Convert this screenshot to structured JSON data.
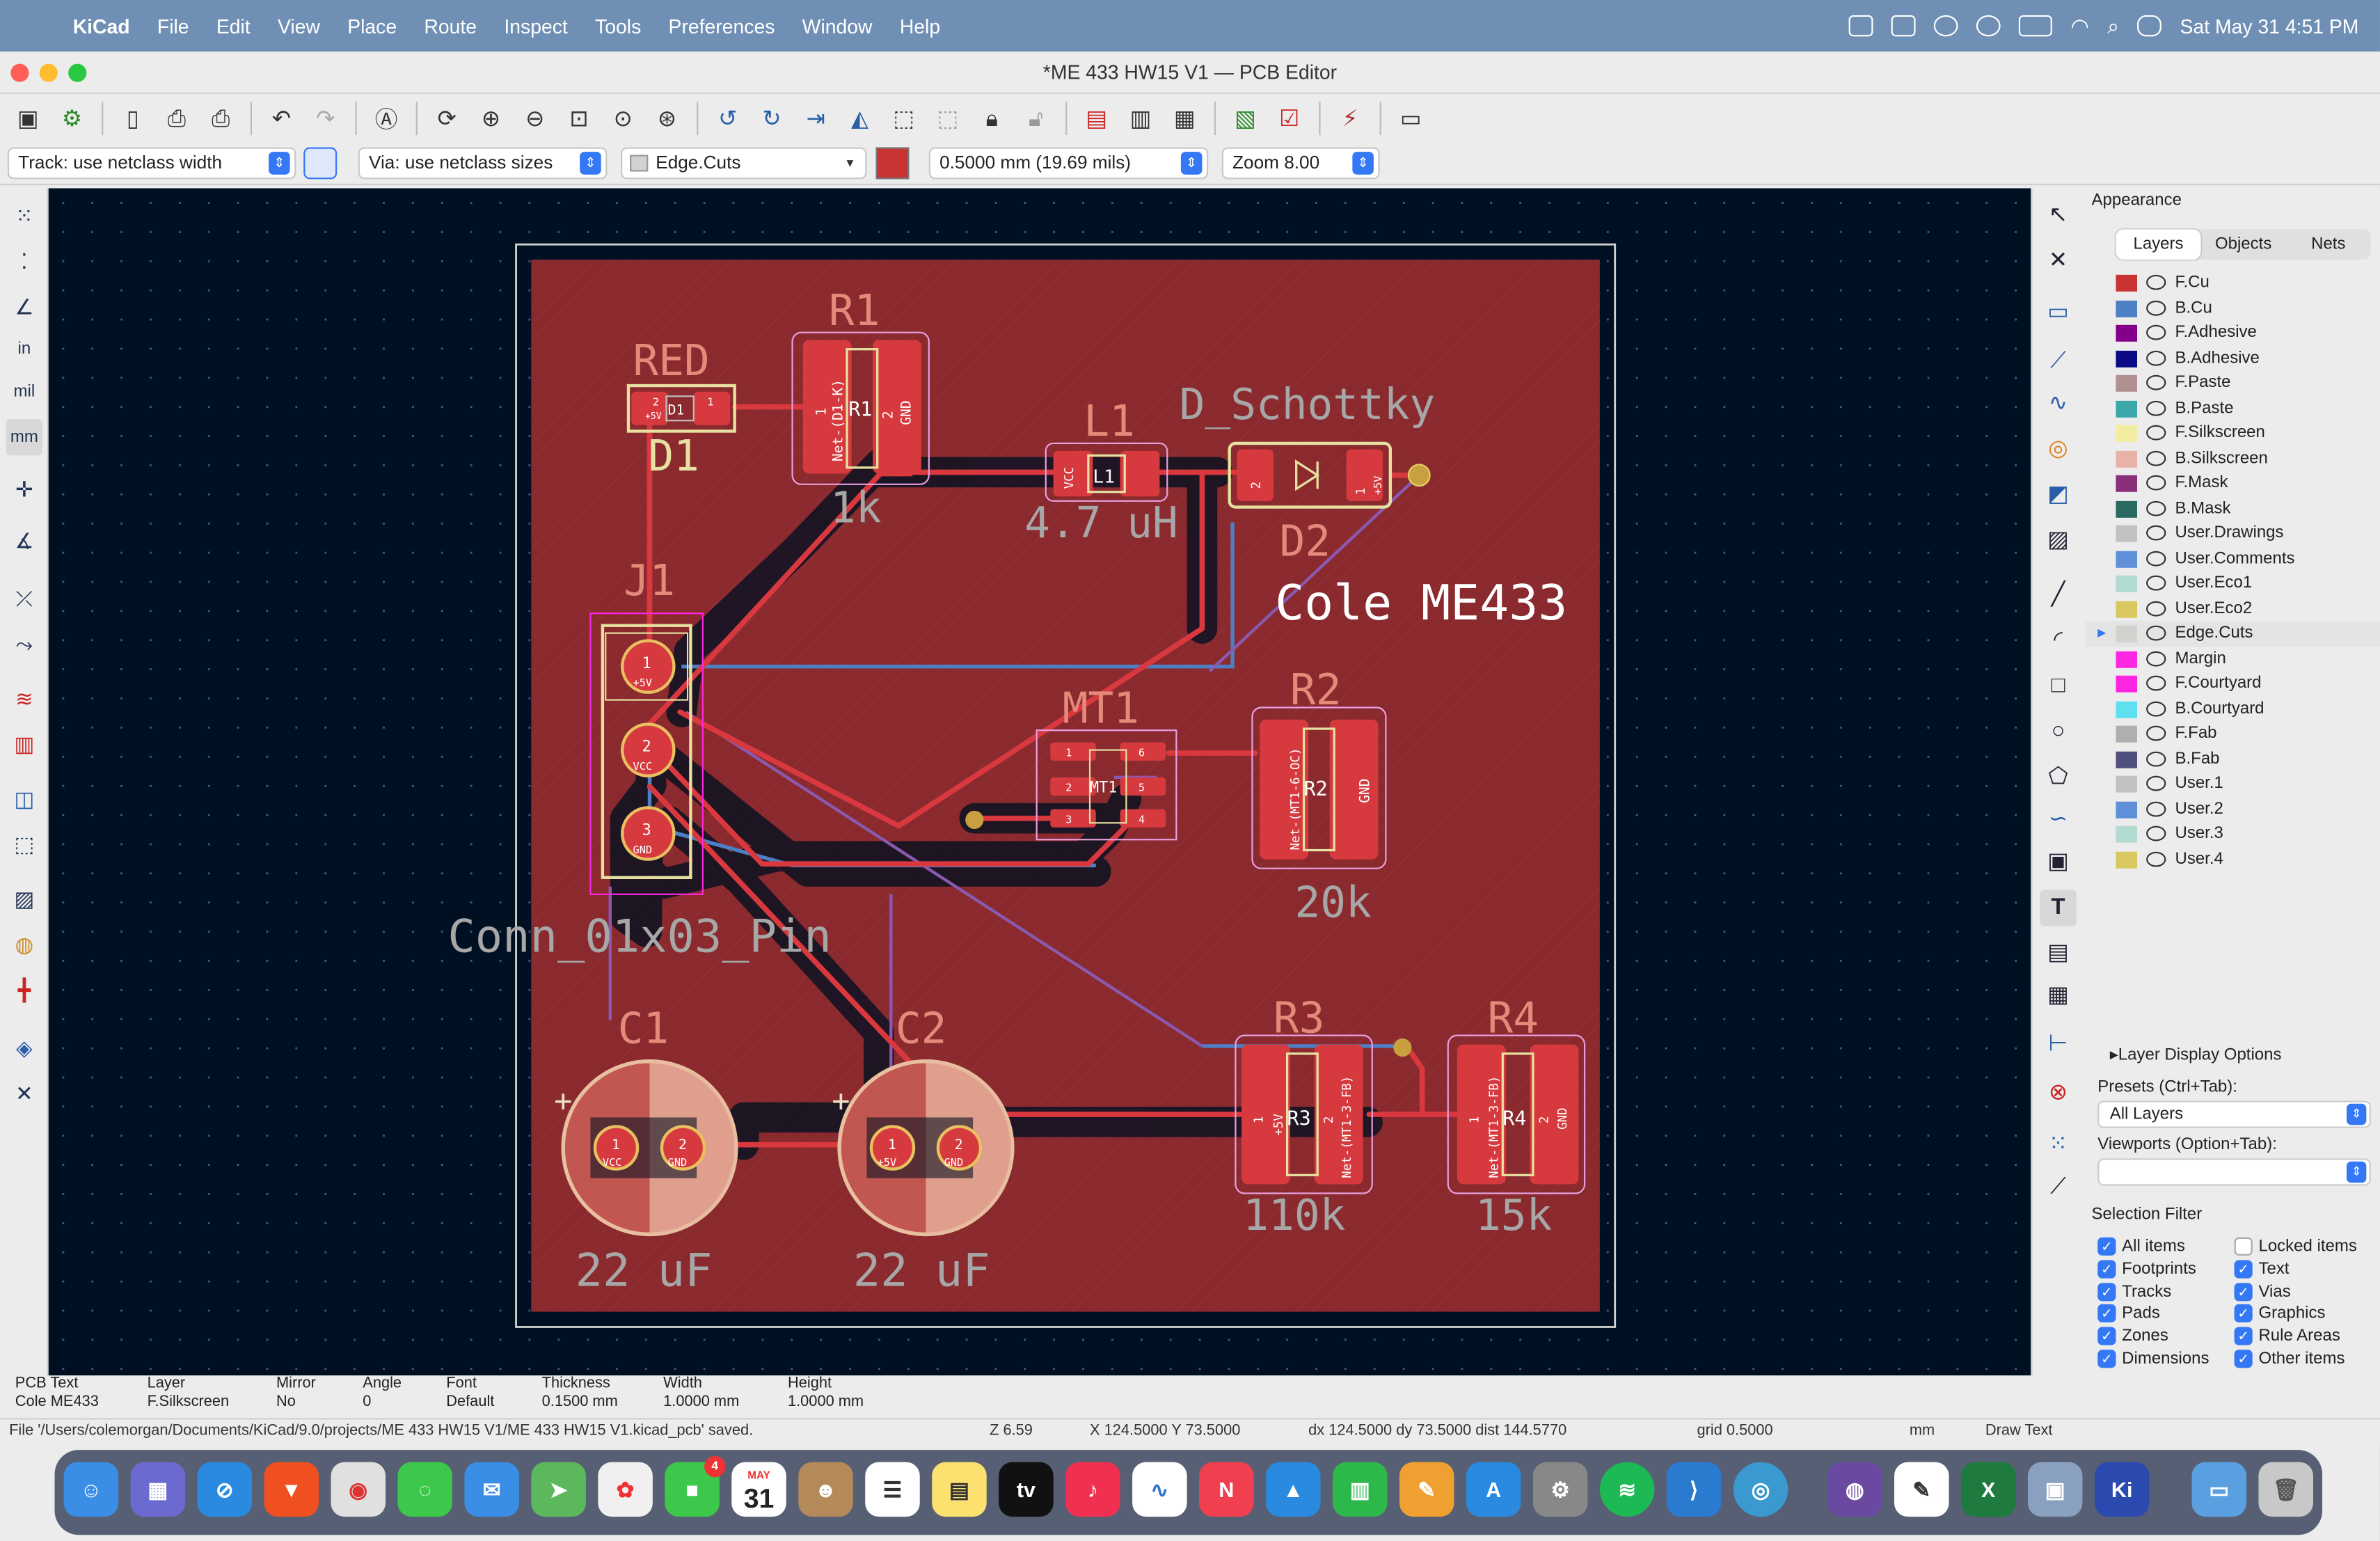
{
  "menubar": {
    "app": "KiCad",
    "items": [
      "File",
      "Edit",
      "View",
      "Place",
      "Route",
      "Inspect",
      "Tools",
      "Preferences",
      "Window",
      "Help"
    ],
    "datetime": "Sat May 31  4:51 PM"
  },
  "window": {
    "title": "*ME 433 HW15 V1 — PCB Editor"
  },
  "options": {
    "track": "Track: use netclass width",
    "via": "Via: use netclass sizes",
    "layer": "Edge.Cuts",
    "line_width": "0.5000 mm (19.69 mils)",
    "zoom": "Zoom 8.00"
  },
  "lefttools": {
    "in": "in",
    "mil": "mil",
    "mm": "mm"
  },
  "board": {
    "labels": {
      "red": "RED",
      "d1": "D1",
      "r1": "R1",
      "r1_val": "1k",
      "l1": "L1",
      "l1_val": "4.7 uH",
      "dsch": "D_Schottky",
      "d2": "D2",
      "cole": "Cole ME433",
      "j1": "J1",
      "mt1": "MT1",
      "r2": "R2",
      "r2_val": "20k",
      "conn": "Conn_01x03_Pin",
      "c1": "C1",
      "c2": "C2",
      "c1_val": "22 uF",
      "c2_val": "22 uF",
      "r3": "R3",
      "r3_val": "110k",
      "r4": "R4",
      "r4_val": "15k"
    },
    "pads": {
      "p1": "1",
      "p2": "2",
      "p3": "3",
      "p4": "4",
      "p5": "5",
      "p6": "6",
      "plus5v": "+5V",
      "vcc": "VCC",
      "gnd": "GND",
      "plus": "+",
      "net_d1k": "Net-(D1-K)",
      "net_mt16": "Net-(MT1-6-OC)",
      "net_mt13": "Net-(MT1-3-FB)",
      "r1_ref": "R1",
      "l1_ref": "L1",
      "mt1_ref": "MT1",
      "r2_ref": "R2",
      "r3_ref": "R3",
      "r4_ref": "R4",
      "d1_ref": "D1"
    }
  },
  "appearance": {
    "title": "Appearance",
    "tabs": [
      "Layers",
      "Objects",
      "Nets"
    ],
    "layers": [
      {
        "name": "F.Cu",
        "color": "#c83434"
      },
      {
        "name": "B.Cu",
        "color": "#4d7fc4"
      },
      {
        "name": "F.Adhesive",
        "color": "#84008b"
      },
      {
        "name": "B.Adhesive",
        "color": "#0a0a84"
      },
      {
        "name": "F.Paste",
        "color": "#b09090"
      },
      {
        "name": "B.Paste",
        "color": "#3aa8a8"
      },
      {
        "name": "F.Silkscreen",
        "color": "#f2eda1"
      },
      {
        "name": "B.Silkscreen",
        "color": "#e8b2a7"
      },
      {
        "name": "F.Mask",
        "color": "#8a2f7a"
      },
      {
        "name": "B.Mask",
        "color": "#2a6a60"
      },
      {
        "name": "User.Drawings",
        "color": "#c2c2c2"
      },
      {
        "name": "User.Comments",
        "color": "#5e8fd8"
      },
      {
        "name": "User.Eco1",
        "color": "#b4dbd2"
      },
      {
        "name": "User.Eco2",
        "color": "#d8c85f"
      },
      {
        "name": "Edge.Cuts",
        "color": "#d0d2cd"
      },
      {
        "name": "Margin",
        "color": "#ff26e2"
      },
      {
        "name": "F.Courtyard",
        "color": "#ff26e2"
      },
      {
        "name": "B.Courtyard",
        "color": "#5ee0f0"
      },
      {
        "name": "F.Fab",
        "color": "#afafaf"
      },
      {
        "name": "B.Fab",
        "color": "#505080"
      },
      {
        "name": "User.1",
        "color": "#c2c2c2"
      },
      {
        "name": "User.2",
        "color": "#5e8fd8"
      },
      {
        "name": "User.3",
        "color": "#b4dbd2"
      },
      {
        "name": "User.4",
        "color": "#d8c85f"
      }
    ],
    "layer_display_options": "Layer Display Options",
    "presets_label": "Presets (Ctrl+Tab):",
    "presets_value": "All Layers",
    "viewports_label": "Viewports (Option+Tab):"
  },
  "selection_filter": {
    "title": "Selection Filter",
    "items": [
      {
        "label": "All items",
        "checked": true
      },
      {
        "label": "Locked items",
        "checked": false
      },
      {
        "label": "Footprints",
        "checked": true
      },
      {
        "label": "Text",
        "checked": true
      },
      {
        "label": "Tracks",
        "checked": true
      },
      {
        "label": "Vias",
        "checked": true
      },
      {
        "label": "Pads",
        "checked": true
      },
      {
        "label": "Graphics",
        "checked": true
      },
      {
        "label": "Zones",
        "checked": true
      },
      {
        "label": "Rule Areas",
        "checked": true
      },
      {
        "label": "Dimensions",
        "checked": true
      },
      {
        "label": "Other items",
        "checked": true
      }
    ]
  },
  "message_panel": [
    {
      "h": "PCB Text",
      "v": "Cole ME433"
    },
    {
      "h": "Layer",
      "v": "F.Silkscreen"
    },
    {
      "h": "Mirror",
      "v": "No"
    },
    {
      "h": "Angle",
      "v": "0"
    },
    {
      "h": "Font",
      "v": "Default"
    },
    {
      "h": "Thickness",
      "v": "0.1500 mm"
    },
    {
      "h": "Width",
      "v": "1.0000 mm"
    },
    {
      "h": "Height",
      "v": "1.0000 mm"
    }
  ],
  "status": {
    "file": "File '/Users/colemorgan/Documents/KiCad/9.0/projects/ME 433 HW15 V1/ME 433 HW15 V1.kicad_pcb' saved.",
    "z": "Z 6.59",
    "xy": "X 124.5000  Y 73.5000",
    "dxy": "dx 124.5000  dy 73.5000  dist 144.5770",
    "grid": "grid 0.5000",
    "units": "mm",
    "mode": "Draw Text"
  },
  "dock": {
    "calendar_month": "MAY",
    "calendar_day": "31",
    "messages_badge": "4",
    "kicad_label": "Ki"
  }
}
